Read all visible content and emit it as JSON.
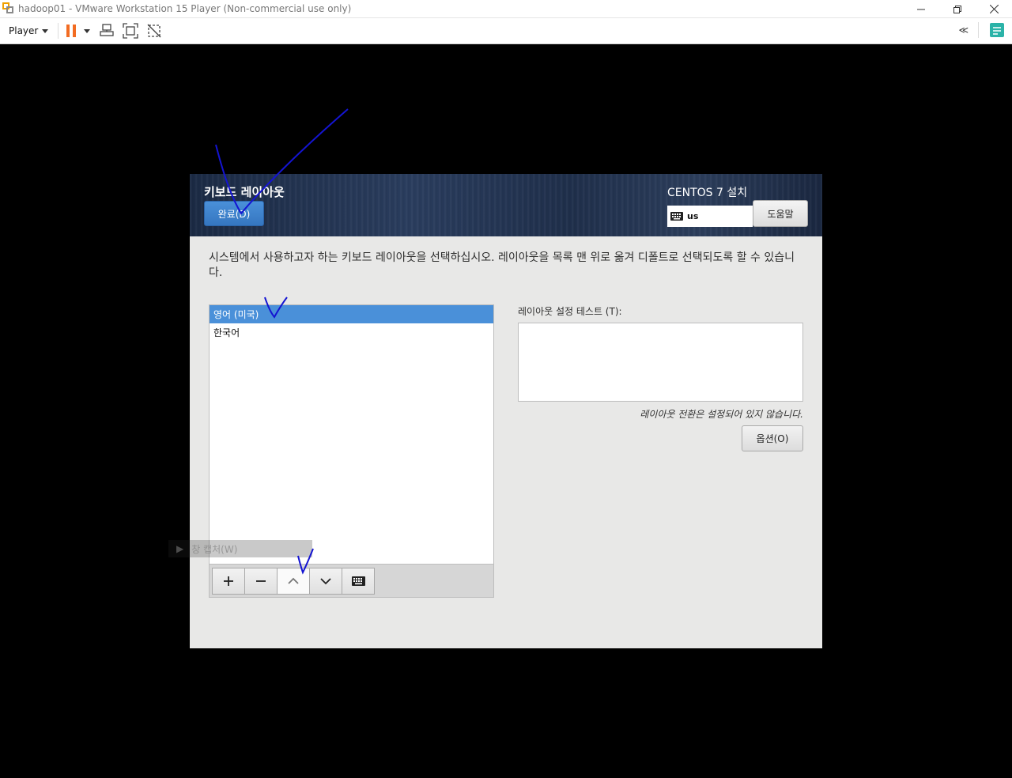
{
  "window": {
    "title": "hadoop01 - VMware Workstation 15 Player (Non-commercial use only)",
    "icon": "vmware-icon",
    "controls": [
      "minimize-icon",
      "restore-icon",
      "close-icon"
    ]
  },
  "toolbar": {
    "player_label": "Player",
    "icons": [
      "pause-icon",
      "dropdown-icon",
      "send-ctrl-alt-del-icon",
      "fullscreen-icon",
      "unity-icon"
    ],
    "right_icons": [
      "collapse-icon",
      "notes-icon"
    ]
  },
  "installer": {
    "page_title": "키보드 레이아웃",
    "done_label": "완료(D)",
    "install_title": "CENTOS 7 설치",
    "keyboard_indicator": "us",
    "help_label": "도움말",
    "instructions": "시스템에서 사용하고자 하는 키보드 레이아웃을 선택하십시오. 레이아웃을 목록 맨 위로 옮겨 디폴트로 선택되도록 할 수 있습니다.",
    "layouts": [
      {
        "label": "영어 (미국)",
        "selected": true
      },
      {
        "label": "한국어",
        "selected": false
      }
    ],
    "list_tools": [
      "add-icon",
      "remove-icon",
      "move-up-icon",
      "move-down-icon",
      "keyboard-preview-icon"
    ],
    "test_label": "레이아웃 설정 테스트 (T):",
    "test_value": "",
    "switch_note": "레이아웃 전환은 설정되어 있지 않습니다.",
    "options_label": "옵션(O)"
  },
  "overlay": {
    "label": "창 캡처(W)"
  },
  "colors": {
    "accent": "#4a90d9",
    "pause": "#f26c22",
    "annotation": "#1414d2",
    "header": "#1f2f4b"
  }
}
